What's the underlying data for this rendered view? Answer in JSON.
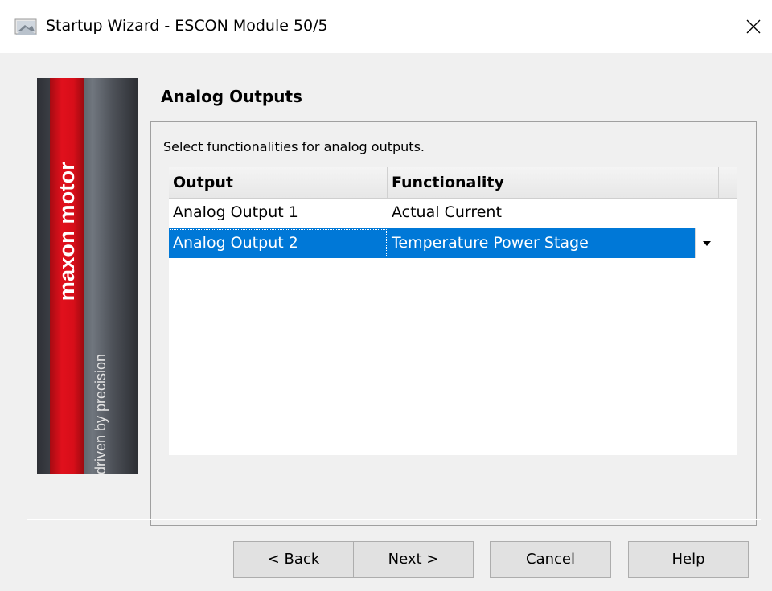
{
  "window": {
    "title": "Startup Wizard - ESCON Module 50/5",
    "icon": "wizard-app-icon",
    "close_icon": "close-icon"
  },
  "banner": {
    "brand": "maxon motor",
    "tagline": "driven by precision",
    "colors": {
      "red": "#e0101c",
      "steel": "#555a61"
    }
  },
  "page": {
    "title": "Analog Outputs",
    "instruction": "Select functionalities for analog outputs."
  },
  "grid": {
    "columns": [
      "Output",
      "Functionality"
    ],
    "rows": [
      {
        "output": "Analog Output 1",
        "functionality": "Actual Current",
        "selected": false
      },
      {
        "output": "Analog Output 2",
        "functionality": "Temperature Power Stage",
        "selected": true
      }
    ],
    "selection_color": "#0078d7"
  },
  "buttons": {
    "back": "< Back",
    "next": "Next >",
    "cancel": "Cancel",
    "help": "Help"
  }
}
